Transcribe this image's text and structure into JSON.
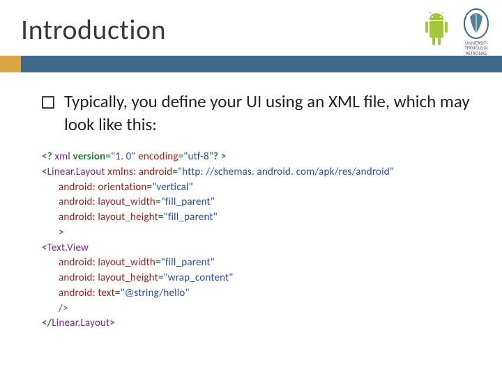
{
  "title": "Introduction",
  "logo_caption": {
    "l1": "UNIVERSITI",
    "l2": "TEKNOLOGI",
    "l3": "PETRONAS"
  },
  "bullet": "Typically, you define your UI using an XML file, which may look like this:",
  "code": {
    "l1": {
      "a": "<? ",
      "b": "xml ",
      "c": "version=",
      "d": "\"1. 0\" ",
      "e": "encoding",
      "f": "=",
      "g": "\"utf-8\"",
      "h": "? >"
    },
    "l2": {
      "a": "<",
      "b": "Linear.Layout ",
      "c": "xmlns: android",
      "d": "=",
      "e": "\"http: //schemas. android. com/apk/res/android\""
    },
    "l3": {
      "a": "android: orientation",
      "b": "=",
      "c": "\"vertical\""
    },
    "l4": {
      "a": "android: layout_width",
      "b": "=",
      "c": "\"fill_parent\""
    },
    "l5": {
      "a": "android: layout_height",
      "b": "=",
      "c": "\"fill_parent\""
    },
    "l6": {
      "a": ">"
    },
    "l7": {
      "a": "<",
      "b": "Text.View"
    },
    "l8": {
      "a": "android: layout_width",
      "b": "=",
      "c": "\"fill_parent\""
    },
    "l9": {
      "a": "android: layout_height",
      "b": "=",
      "c": "\"wrap_content\""
    },
    "l10": {
      "a": "android: text",
      "b": "=",
      "c": "\"@string/hello\""
    },
    "l11": {
      "a": "/>"
    },
    "l12": {
      "a": "</",
      "b": "Linear.Layout",
      "c": ">"
    }
  }
}
